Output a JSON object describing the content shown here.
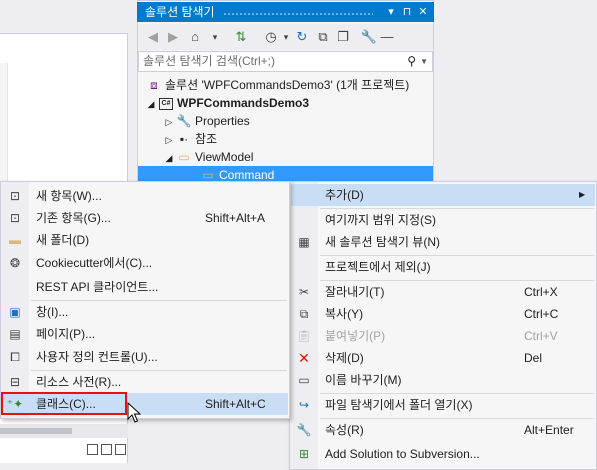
{
  "solution_explorer": {
    "title": "솔루션 탐색기",
    "title_buttons": [
      "▾",
      "⊓",
      "✕"
    ],
    "toolbar_icons": [
      "back-icon",
      "forward-icon",
      "home-icon",
      "sync-icon",
      "history-icon",
      "refresh-icon",
      "collapse-icon",
      "show-all-icon",
      "properties-icon"
    ],
    "search_placeholder": "솔루션 탐색기 검색(Ctrl+;)",
    "tree": [
      {
        "label": "솔루션 'WPFCommandsDemo3' (1개 프로젝트)",
        "icon": "solution-icon"
      },
      {
        "label": "WPFCommandsDemo3",
        "icon": "csharp-project-icon",
        "bold": true
      },
      {
        "label": "Properties",
        "icon": "wrench-icon"
      },
      {
        "label": "참조",
        "icon": "references-icon"
      },
      {
        "label": "ViewModel",
        "icon": "folder-open-icon"
      },
      {
        "label": "Command",
        "icon": "folder-icon",
        "selected": true
      }
    ]
  },
  "right_menu": {
    "items": [
      {
        "label": "추가(D)",
        "shortcut": "",
        "icon": "",
        "submenu": true,
        "highlighted": true
      },
      {
        "label": "여기까지 범위 지정(S)",
        "shortcut": "",
        "icon": ""
      },
      {
        "label": "새 솔루션 탐색기 뷰(N)",
        "shortcut": "",
        "icon": "new-view-icon"
      },
      {
        "label": "프로젝트에서 제외(J)",
        "shortcut": "",
        "icon": ""
      },
      {
        "label": "잘라내기(T)",
        "shortcut": "Ctrl+X",
        "icon": "scissors-icon"
      },
      {
        "label": "복사(Y)",
        "shortcut": "Ctrl+C",
        "icon": "copy-icon"
      },
      {
        "label": "붙여넣기(P)",
        "shortcut": "Ctrl+V",
        "icon": "paste-icon",
        "disabled": true
      },
      {
        "label": "삭제(D)",
        "shortcut": "Del",
        "icon": "delete-x-icon"
      },
      {
        "label": "이름 바꾸기(M)",
        "shortcut": "",
        "icon": "rename-icon"
      },
      {
        "label": "파일 탐색기에서 폴더 열기(X)",
        "shortcut": "",
        "icon": "open-folder-arrow-icon"
      },
      {
        "label": "속성(R)",
        "shortcut": "Alt+Enter",
        "icon": "wrench-icon"
      },
      {
        "label": "Add Solution to Subversion...",
        "shortcut": "",
        "icon": "subversion-add-icon"
      }
    ]
  },
  "left_menu": {
    "items": [
      {
        "label": "새 항목(W)...",
        "shortcut": "",
        "icon": "new-item-icon"
      },
      {
        "label": "기존 항목(G)...",
        "shortcut": "Shift+Alt+A",
        "icon": "existing-item-icon"
      },
      {
        "label": "새 폴더(D)",
        "shortcut": "",
        "icon": "new-folder-icon"
      },
      {
        "label": "Cookiecutter에서(C)...",
        "shortcut": "",
        "icon": "cookiecutter-icon"
      },
      {
        "label": "REST API 클라이언트...",
        "shortcut": "",
        "icon": ""
      },
      {
        "label": "창(I)...",
        "shortcut": "",
        "icon": "window-icon"
      },
      {
        "label": "페이지(P)...",
        "shortcut": "",
        "icon": "page-icon"
      },
      {
        "label": "사용자 정의 컨트롤(U)...",
        "shortcut": "",
        "icon": "user-control-icon"
      },
      {
        "label": "리소스 사전(R)...",
        "shortcut": "",
        "icon": "resource-dictionary-icon"
      },
      {
        "label": "클래스(C)...",
        "shortcut": "Shift+Alt+C",
        "icon": "class-icon",
        "highlighted": true
      }
    ]
  },
  "colors": {
    "accent": "#007acc",
    "tree_selection": "#3399ff",
    "menu_highlight": "#c9def5",
    "focus_box": "#e51400"
  }
}
